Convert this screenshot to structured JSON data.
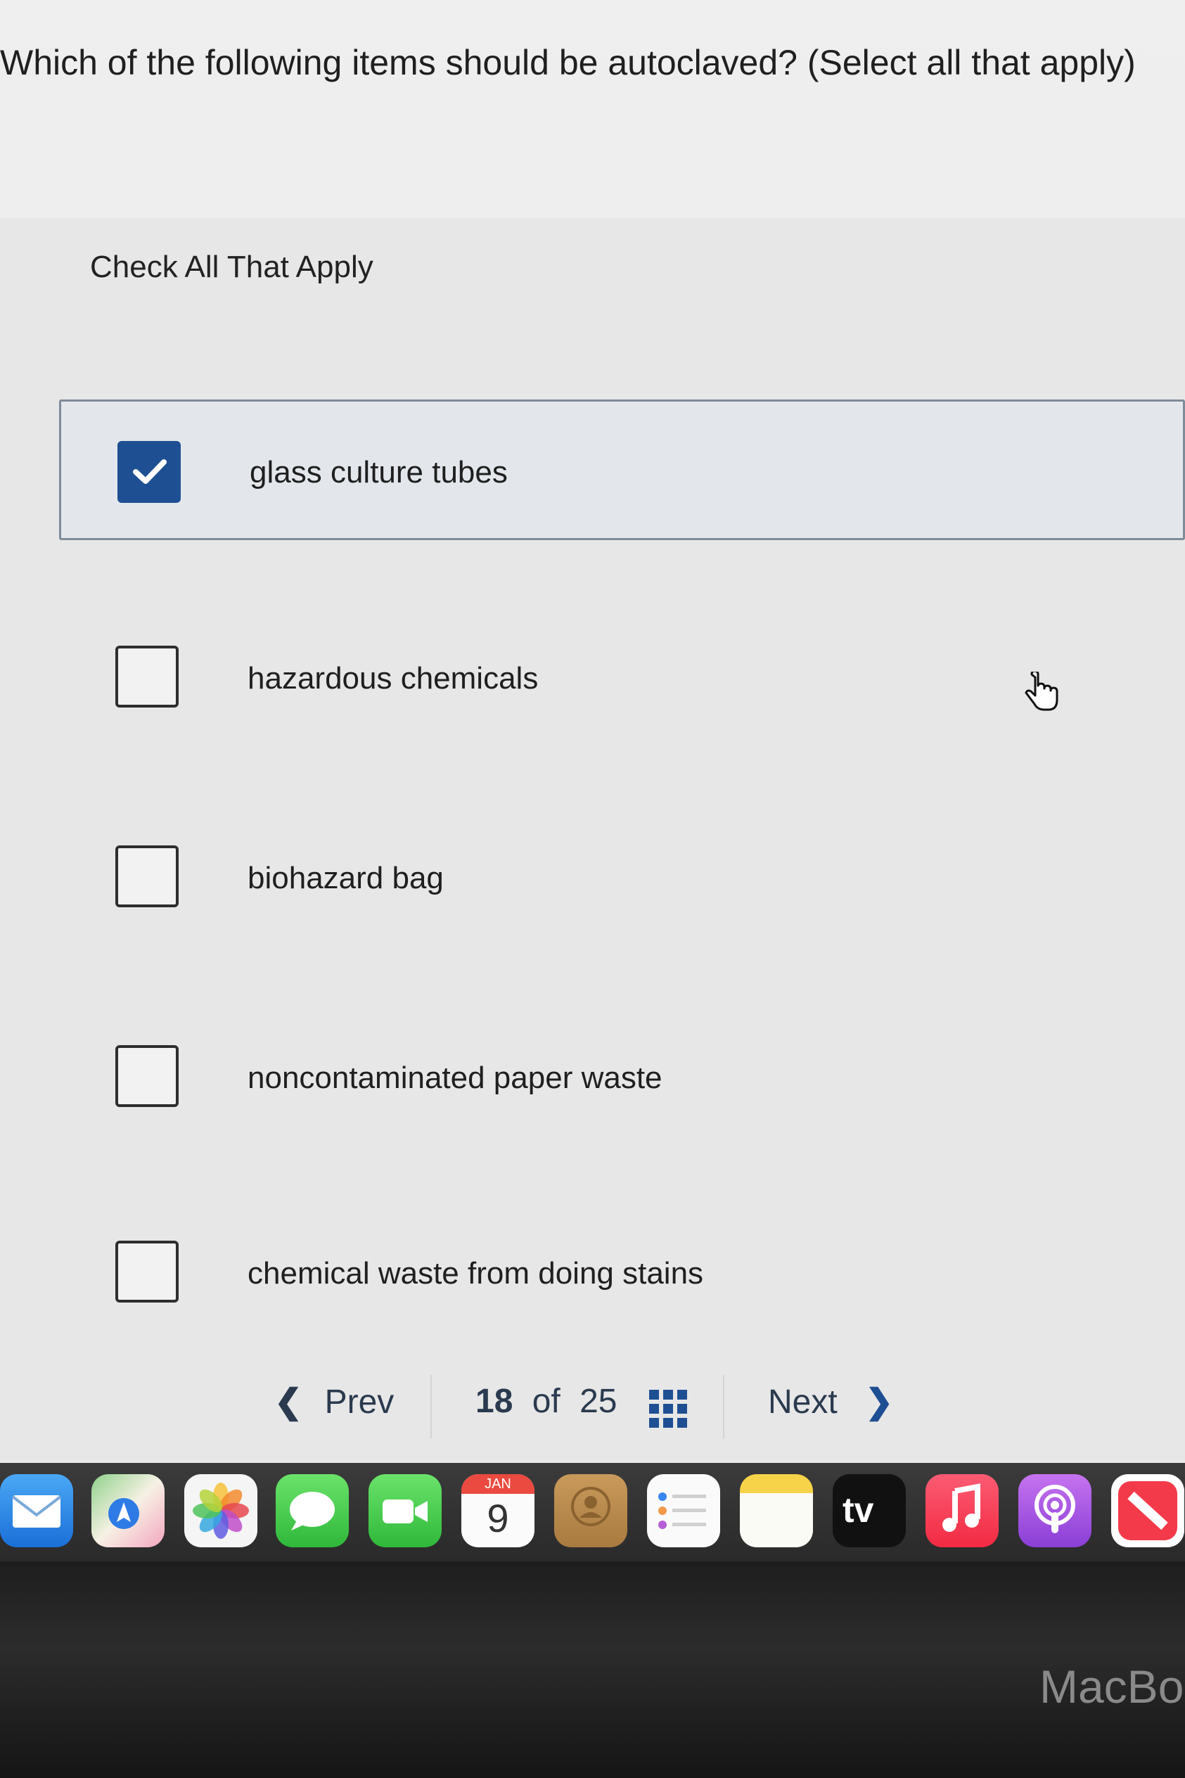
{
  "question": {
    "text": "Which of the following items should be autoclaved? (Select all that apply)"
  },
  "instructions": "Check All That Apply",
  "options": [
    {
      "label": "glass culture tubes",
      "checked": true
    },
    {
      "label": "hazardous chemicals",
      "checked": false
    },
    {
      "label": "biohazard bag",
      "checked": false
    },
    {
      "label": "noncontaminated paper waste",
      "checked": false
    },
    {
      "label": "chemical waste from doing stains",
      "checked": false
    }
  ],
  "navigation": {
    "prev_label": "Prev",
    "current_page": "18",
    "of_label": "of",
    "total_pages": "25",
    "next_label": "Next"
  },
  "dock": {
    "calendar_month": "JAN",
    "calendar_day": "9",
    "tv_label": "tv",
    "apps": [
      "mail-icon",
      "maps-icon",
      "photos-icon",
      "messages-icon",
      "facetime-icon",
      "calendar-icon",
      "contacts-icon",
      "reminders-icon",
      "notes-icon",
      "apple-tv-icon",
      "music-icon",
      "podcasts-icon",
      "news-icon"
    ]
  },
  "device_label": "MacBo",
  "colors": {
    "checked_box": "#1f4f93",
    "selected_option_bg": "#e3e7ec",
    "nav_text": "#2a3a4f"
  }
}
